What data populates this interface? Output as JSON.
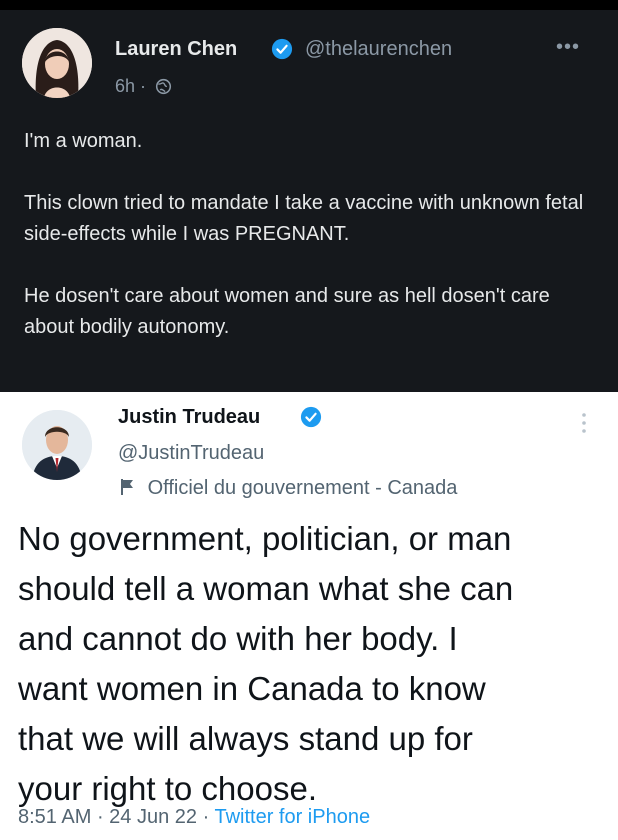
{
  "tweet1": {
    "author_name": "Lauren Chen",
    "handle": "@thelaurenchen",
    "time": "6h",
    "separator": "·",
    "more_label": "•••",
    "paragraphs": [
      "I'm a woman.",
      "This clown tried to mandate I take a vaccine with unknown fetal side-effects while I was PREGNANT.",
      "He dosen't care about women and sure as hell dosen't care about bodily autonomy."
    ],
    "icons": {
      "verified": "verified-badge-icon",
      "audience": "globe-icon",
      "more": "more-horizontal-icon"
    },
    "colors": {
      "background": "#15181c",
      "text": "#e7e9ea",
      "secondary": "#8b98a5",
      "verified": "#1d9bf0"
    }
  },
  "tweet2": {
    "author_name": "Justin Trudeau",
    "handle": "@JustinTrudeau",
    "government_label": "Officiel du gouvernement - Canada",
    "body": "No government, politician, or man\nshould tell a woman what she can\nand cannot do with her body. I\nwant women in Canada to know\nthat we will always stand up for\nyour right to choose.",
    "footer": {
      "time": "8:51 AM",
      "separator": " · ",
      "date": "24 Jun 22",
      "source": "Twitter for iPhone"
    },
    "icons": {
      "verified": "verified-badge-icon",
      "government": "government-flag-icon",
      "more": "more-vertical-icon"
    },
    "colors": {
      "background": "#ffffff",
      "text": "#0f1419",
      "secondary": "#536471",
      "link": "#1d9bf0"
    }
  }
}
